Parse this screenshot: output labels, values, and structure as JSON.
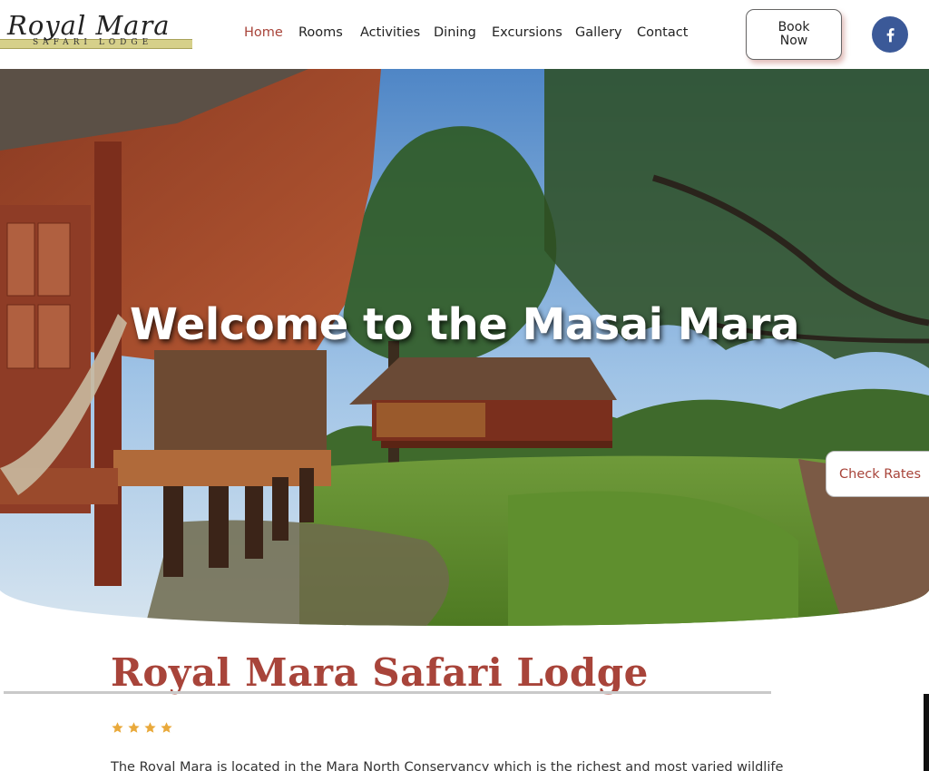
{
  "brand": {
    "logo_script": "Royal Mara",
    "logo_sub": "SAFARI LODGE"
  },
  "nav": {
    "items": [
      {
        "label": "Home",
        "active": true
      },
      {
        "label": "Rooms",
        "active": false
      },
      {
        "label": "Activities",
        "active": false
      },
      {
        "label": "Dining",
        "active": false
      },
      {
        "label": "Excursions",
        "active": false
      },
      {
        "label": "Gallery",
        "active": false
      },
      {
        "label": "Contact",
        "active": false
      }
    ],
    "book_label": "Book Now",
    "social_icon": "facebook-icon"
  },
  "hero": {
    "title": "Welcome to the Masai Mara",
    "check_rates_label": "Check Rates"
  },
  "content": {
    "title": "Royal Mara Safari Lodge",
    "rating_stars": 4,
    "intro": "The Royal Mara is located in the Mara North Conservancy which is the richest and most varied wildlife"
  },
  "colors": {
    "accent": "#a8443a",
    "facebook": "#3b5998",
    "star": "#e9a93b"
  }
}
